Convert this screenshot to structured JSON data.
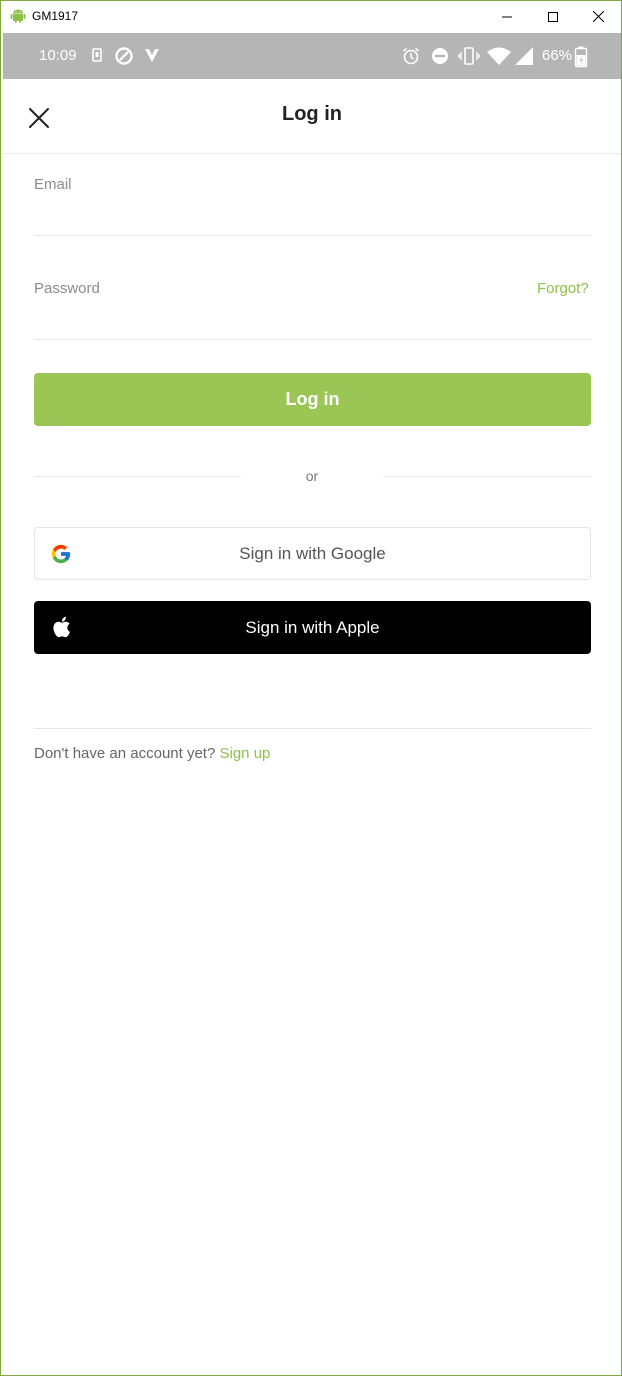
{
  "window": {
    "title": "GM1917",
    "controls": {
      "minimize_icon": "minimize-icon",
      "maximize_icon": "maximize-icon",
      "close_icon": "close-icon"
    }
  },
  "statusbar": {
    "time": "10:09",
    "battery_percent": "66%",
    "icons": [
      "sim-icon",
      "data-saver-icon",
      "vpn-icon",
      "alarm-icon",
      "do-not-disturb-icon",
      "vibrate-icon",
      "wifi-icon",
      "signal-icon",
      "battery-icon"
    ]
  },
  "header": {
    "title": "Log in",
    "close_icon": "close-icon"
  },
  "form": {
    "email_label": "Email",
    "email_value": "",
    "password_label": "Password",
    "password_value": "",
    "forgot_label": "Forgot?",
    "login_button": "Log in"
  },
  "divider": {
    "or_label": "or"
  },
  "social": {
    "google_label": "Sign in with Google",
    "apple_label": "Sign in with Apple"
  },
  "footer": {
    "prompt": "Don't have an account yet?",
    "signup_label": "Sign up"
  },
  "colors": {
    "accent": "#9bc656",
    "link": "#8dc14a",
    "statusbar_bg": "#b5b5b5",
    "apple_bg": "#000000"
  }
}
